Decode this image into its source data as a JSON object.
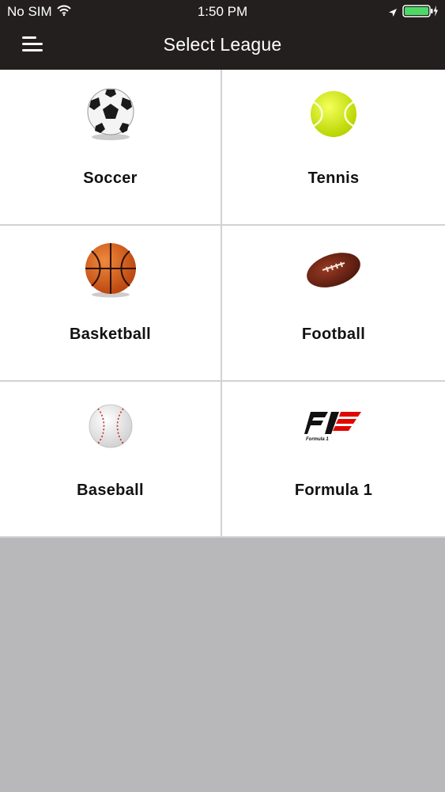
{
  "status_bar": {
    "carrier": "No SIM",
    "time": "1:50 PM",
    "icons": [
      "wifi-icon",
      "location-arrow-icon",
      "battery-charging-icon"
    ]
  },
  "nav": {
    "title": "Select League",
    "menu_icon": "hamburger-menu-icon"
  },
  "leagues": [
    {
      "label": "Soccer",
      "icon": "soccer-ball-icon"
    },
    {
      "label": "Tennis",
      "icon": "tennis-ball-icon"
    },
    {
      "label": "Basketball",
      "icon": "basketball-icon"
    },
    {
      "label": "Football",
      "icon": "american-football-icon"
    },
    {
      "label": "Baseball",
      "icon": "baseball-icon"
    },
    {
      "label": "Formula 1",
      "icon": "formula-1-logo-icon"
    }
  ],
  "colors": {
    "header_bg": "#231f1f",
    "grid_bg": "#ffffff",
    "divider": "#d3d1d6",
    "empty_area": "#b8b7ba",
    "battery": "#4cd964"
  }
}
